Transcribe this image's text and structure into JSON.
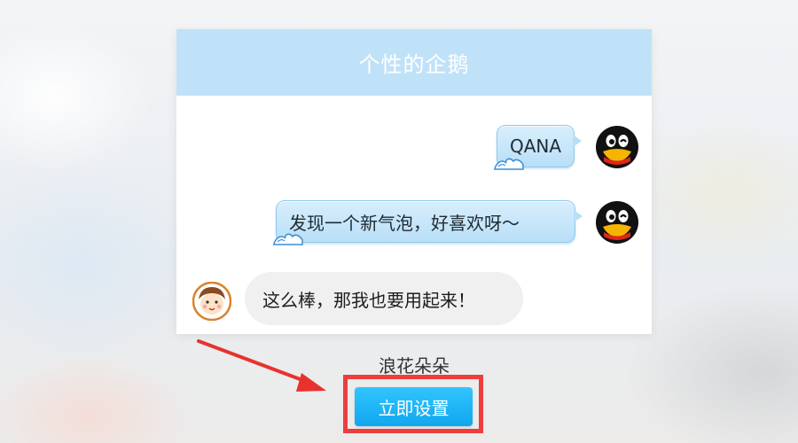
{
  "header": {
    "title": "个性的企鹅"
  },
  "messages": [
    {
      "text": "QANA",
      "avatar": "qq-penguin-icon"
    },
    {
      "text": "发现一个新气泡，好喜欢呀～",
      "avatar": "qq-penguin-icon"
    }
  ],
  "reply": {
    "text": "这么棒，那我也要用起来！",
    "avatar": "cartoon-boy-icon"
  },
  "bubble_theme": {
    "name": "浪花朵朵"
  },
  "action": {
    "label": "立即设置"
  },
  "colors": {
    "header_bg": "#c0e2f8",
    "bubble_blue": "#b9dff7",
    "button_blue": "#1fb1f3",
    "highlight_red": "#ee3d3d"
  }
}
